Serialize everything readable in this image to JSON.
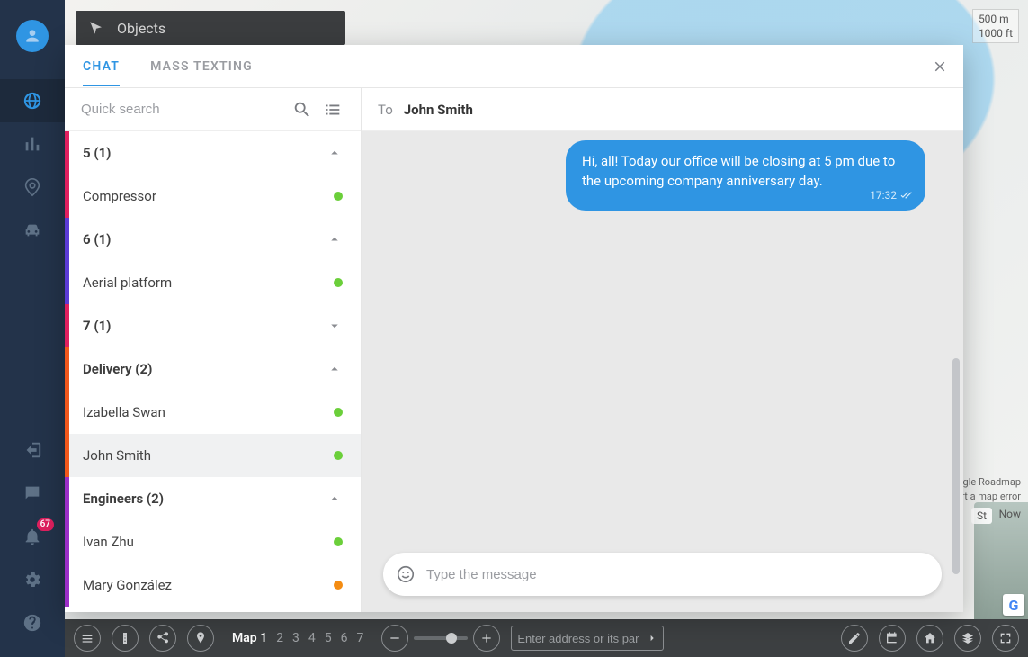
{
  "sidebar": {
    "badge_count": "67"
  },
  "map": {
    "scale_metric": "500 m",
    "scale_imperial": "1000 ft",
    "attrib_layer": "gle Roadmap",
    "attrib_report": "ort a map error",
    "sv_label": "St",
    "sv_now": "Now"
  },
  "objects_bar": {
    "title": "Objects"
  },
  "modal": {
    "tabs": {
      "chat": "CHAT",
      "mass": "MASS TEXTING"
    },
    "search_placeholder": "Quick search",
    "to_label": "To",
    "recipient": "John Smith",
    "message": {
      "text": "Hi, all! Today our office will be closing at 5 pm due to the upcoming company anniversary day.",
      "time": "17:32"
    },
    "compose_placeholder": "Type the message",
    "groups": [
      {
        "stripe": "#e0205f",
        "header": "5 (1)",
        "expanded": true,
        "items": [
          {
            "name": "Compressor",
            "status": "green"
          }
        ]
      },
      {
        "stripe": "#5b3bd4",
        "header": "6 (1)",
        "expanded": true,
        "items": [
          {
            "name": "Aerial platform",
            "status": "green"
          }
        ]
      },
      {
        "stripe": "#e0205f",
        "header": "7 (1)",
        "expanded": false,
        "items": []
      },
      {
        "stripe": "#f2581b",
        "header": "Delivery (2)",
        "expanded": true,
        "items": [
          {
            "name": "Izabella Swan",
            "status": "green"
          },
          {
            "name": "John Smith",
            "status": "green",
            "selected": true
          }
        ]
      },
      {
        "stripe": "#9b2fc7",
        "header": "Engineers (2)",
        "expanded": true,
        "items": [
          {
            "name": "Ivan Zhu",
            "status": "green"
          },
          {
            "name": "Mary González",
            "status": "orange"
          }
        ]
      }
    ]
  },
  "bottombar": {
    "map_label": "Map 1",
    "pages": [
      "2",
      "3",
      "4",
      "5",
      "6",
      "7"
    ],
    "address_placeholder": "Enter address or its par"
  }
}
